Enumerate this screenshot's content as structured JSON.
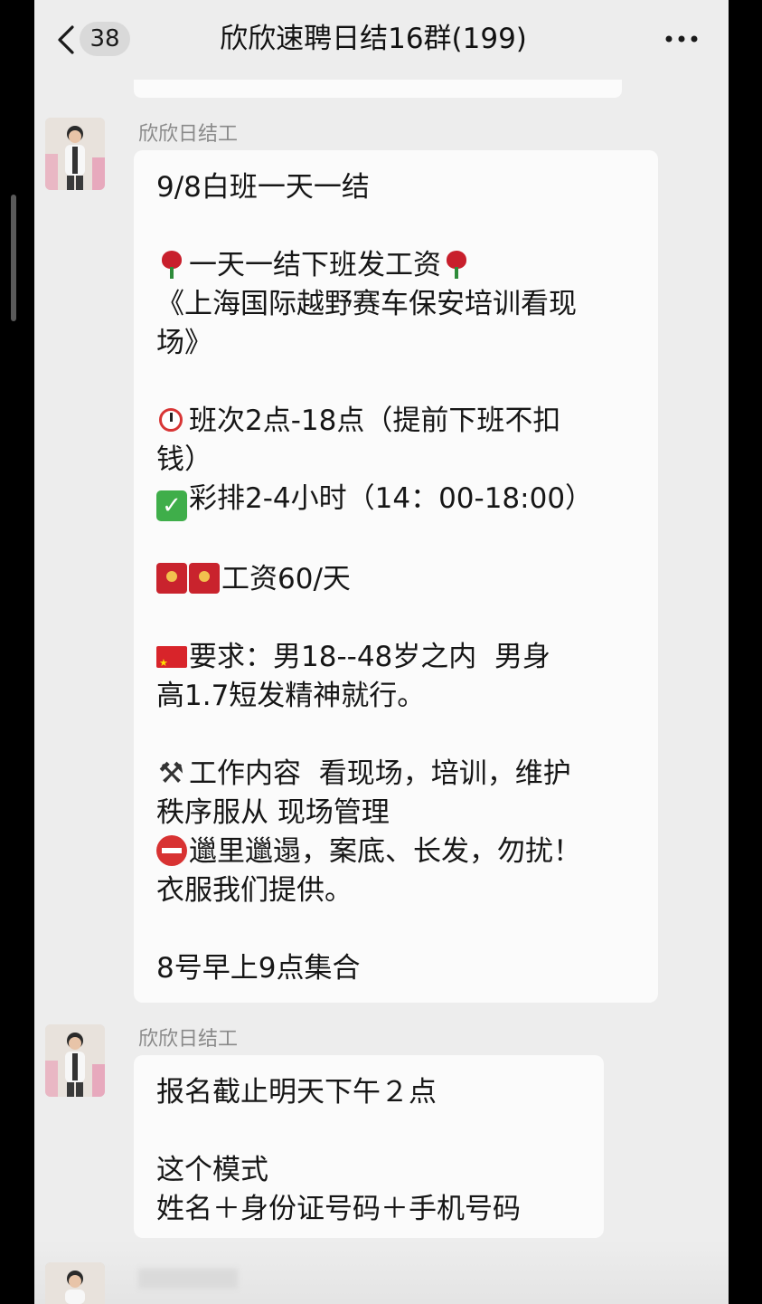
{
  "nav": {
    "unread_count": "38",
    "title": "欣欣速聘日结16群(199)"
  },
  "messages": [
    {
      "sender": "欣欣日结工",
      "lines": [
        {
          "emoji": "",
          "text": "9/8白班一天一结"
        },
        {
          "emoji": "",
          "text": ""
        },
        {
          "emoji": "rose",
          "text": "一天一结下班发工资",
          "trailing_emoji": "rose"
        },
        {
          "emoji": "",
          "text": "《上海国际越野赛车保安培训看现"
        },
        {
          "emoji": "",
          "text": "场》"
        },
        {
          "emoji": "",
          "text": ""
        },
        {
          "emoji": "clock",
          "text": "班次2点-18点（提前下班不扣"
        },
        {
          "emoji": "",
          "text": "钱）"
        },
        {
          "emoji": "check",
          "text": "彩排2-4小时（14：00-18:00）"
        },
        {
          "emoji": "",
          "text": ""
        },
        {
          "emoji": "red-envelope-x2",
          "text": "工资60/天"
        },
        {
          "emoji": "",
          "text": ""
        },
        {
          "emoji": "china-flag",
          "text": "要求：男18--48岁之内  男身"
        },
        {
          "emoji": "",
          "text": "高1.7短发精神就行。"
        },
        {
          "emoji": "",
          "text": ""
        },
        {
          "emoji": "hammer-pick",
          "text": "工作内容  看现场，培训，维护"
        },
        {
          "emoji": "",
          "text": "秩序服从 现场管理"
        },
        {
          "emoji": "no-entry",
          "text": "邋里邋遢，案底、长发，勿扰！"
        },
        {
          "emoji": "",
          "text": "衣服我们提供。"
        },
        {
          "emoji": "",
          "text": ""
        },
        {
          "emoji": "",
          "text": "8号早上9点集合"
        }
      ]
    },
    {
      "sender": "欣欣日结工",
      "lines": [
        {
          "emoji": "",
          "text": "报名截止明天下午２点"
        },
        {
          "emoji": "",
          "text": ""
        },
        {
          "emoji": "",
          "text": "这个模式"
        },
        {
          "emoji": "",
          "text": "姓名＋身份证号码＋手机号码"
        }
      ]
    }
  ]
}
